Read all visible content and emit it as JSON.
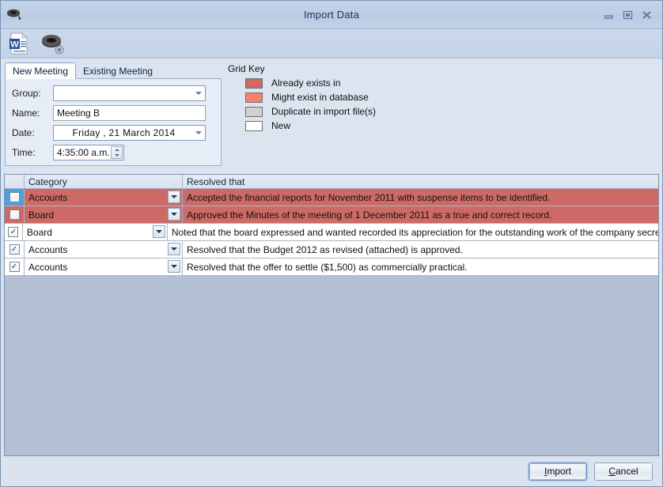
{
  "window": {
    "title": "Import Data",
    "app_icon": "scanner-icon",
    "controls": {
      "minimize": "minimize-icon",
      "restore": "restore-icon",
      "close": "close-icon"
    }
  },
  "toolbar": {
    "items": [
      {
        "icon": "word-document-icon",
        "name": "import-word-document"
      },
      {
        "icon": "scanner-settings-icon",
        "name": "import-settings"
      }
    ]
  },
  "tabs": [
    {
      "label": "New Meeting",
      "active": true
    },
    {
      "label": "Existing Meeting",
      "active": false
    }
  ],
  "form": {
    "group": {
      "label": "Group:",
      "value": "",
      "placeholder": ""
    },
    "name": {
      "label": "Name:",
      "value": "Meeting B",
      "placeholder": ""
    },
    "date": {
      "label": "Date:",
      "value": "Friday    ,  21    March     2014"
    },
    "time": {
      "label": "Time:",
      "value": "4:35:00 a.m."
    }
  },
  "grid_key": {
    "title": "Grid Key",
    "entries": [
      {
        "label": "Already exists in",
        "color": "#cd6a66"
      },
      {
        "label": "Might exist in database",
        "color": "#f98070"
      },
      {
        "label": "Duplicate in import file(s)",
        "color": "#d4d0cd"
      },
      {
        "label": "New",
        "color": "#ffffff"
      }
    ]
  },
  "grid": {
    "columns": [
      "",
      "Category",
      "Resolved that"
    ],
    "rows": [
      {
        "checked": false,
        "selected": true,
        "category": "Accounts",
        "resolved": "Accepted the financial reports for November 2011 with suspense items to be identified.",
        "state": "exists"
      },
      {
        "checked": false,
        "selected": false,
        "category": "Board",
        "resolved": "Approved the Minutes of the meeting of 1 December 2011 as a true and correct record.",
        "state": "exists"
      },
      {
        "checked": true,
        "selected": false,
        "category": "Board",
        "resolved": "Noted that the board expressed and wanted recorded its appreciation for the outstanding work of the company secretary in re...",
        "state": "new"
      },
      {
        "checked": true,
        "selected": false,
        "category": "Accounts",
        "resolved": "Resolved that the Budget 2012 as revised (attached) is approved.",
        "state": "new"
      },
      {
        "checked": true,
        "selected": false,
        "category": "Accounts",
        "resolved": "Resolved that the offer to settle ($1,500) as commercially practical.",
        "state": "new"
      }
    ]
  },
  "footer": {
    "import": {
      "label": "Import",
      "mnemonic": "I",
      "rest": "mport",
      "focused": true
    },
    "cancel": {
      "label": "Cancel",
      "mnemonic": "C",
      "rest": "ancel",
      "focused": false
    }
  }
}
